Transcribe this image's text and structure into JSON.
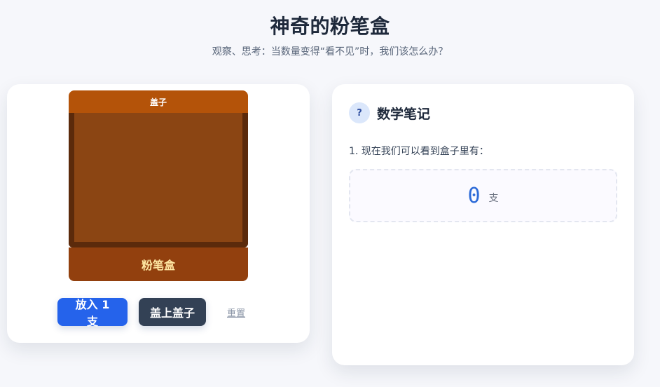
{
  "header": {
    "title": "神奇的粉笔盒",
    "subtitle": "观察、思考：当数量变得“看不见”时，我们该怎么办？"
  },
  "left_panel": {
    "lid_label": "盖子",
    "box_label": "粉笔盒",
    "buttons": {
      "add_label": "放入 1 支",
      "cover_label": "盖上盖子",
      "reset_label": "重置"
    }
  },
  "right_panel": {
    "icon_glyph": "?",
    "title": "数学笔记",
    "question": "1. 现在我们可以看到盒子里有：",
    "answer": {
      "count": "0",
      "unit": "支"
    }
  },
  "colors": {
    "primary_button": "#2563eb",
    "dark_button": "#334155",
    "lid": "#b45309",
    "box_inner": "#8b4513",
    "box_front": "#92400e",
    "count_text": "#2d6bd8"
  },
  "icons": {
    "note_icon": "question-circle-icon"
  }
}
